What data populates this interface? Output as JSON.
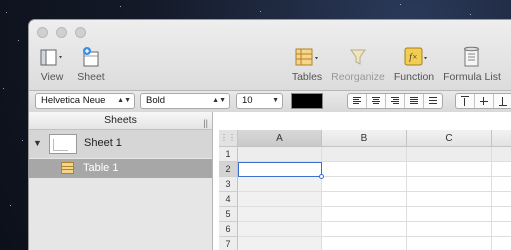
{
  "toolbar": {
    "view_label": "View",
    "sheet_label": "Sheet",
    "tables_label": "Tables",
    "reorganize_label": "Reorganize",
    "function_label": "Function",
    "formula_list_label": "Formula List"
  },
  "format_bar": {
    "font_family": "Helvetica Neue",
    "font_style": "Bold",
    "font_size": "10",
    "text_color": "#000000"
  },
  "sidebar": {
    "header": "Sheets",
    "sheet_name": "Sheet 1",
    "table_name": "Table 1"
  },
  "grid": {
    "columns": [
      "A",
      "B",
      "C"
    ],
    "rows": [
      "1",
      "2",
      "3",
      "4",
      "5",
      "6",
      "7"
    ],
    "selected_cell": "A2",
    "selection_color": "#3a6fd0"
  }
}
